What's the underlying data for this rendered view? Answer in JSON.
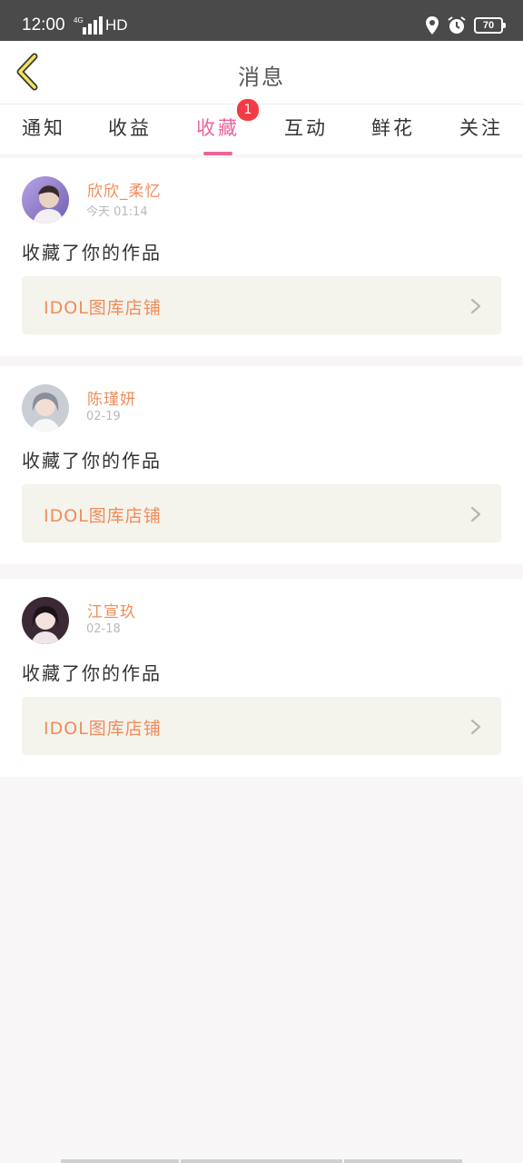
{
  "status_bar": {
    "time": "12:00",
    "network": "HD",
    "network_badge": "4G",
    "battery": "70",
    "icons": [
      "location-icon",
      "alarm-icon",
      "battery-icon"
    ]
  },
  "header": {
    "title": "消息",
    "back_icon": "chevron-left-icon"
  },
  "tabs": [
    {
      "label": "通知"
    },
    {
      "label": "收益"
    },
    {
      "label": "收藏",
      "active": true,
      "badge": "1"
    },
    {
      "label": "互动"
    },
    {
      "label": "鲜花"
    },
    {
      "label": "关注"
    }
  ],
  "messages": [
    {
      "user": "欣欣_柔忆",
      "time": "今天 01:14",
      "text": "收藏了你的作品",
      "link": "IDOL图库店铺"
    },
    {
      "user": "陈瑾妍",
      "time": "02-19",
      "text": "收藏了你的作品",
      "link": "IDOL图库店铺"
    },
    {
      "user": "江宣玖",
      "time": "02-18",
      "text": "收藏了你的作品",
      "link": "IDOL图库店铺"
    }
  ],
  "colors": {
    "accent": "#e9649c",
    "name": "#f08c5a",
    "badge": "#f23b44",
    "back_icon": "#f2e35a"
  }
}
